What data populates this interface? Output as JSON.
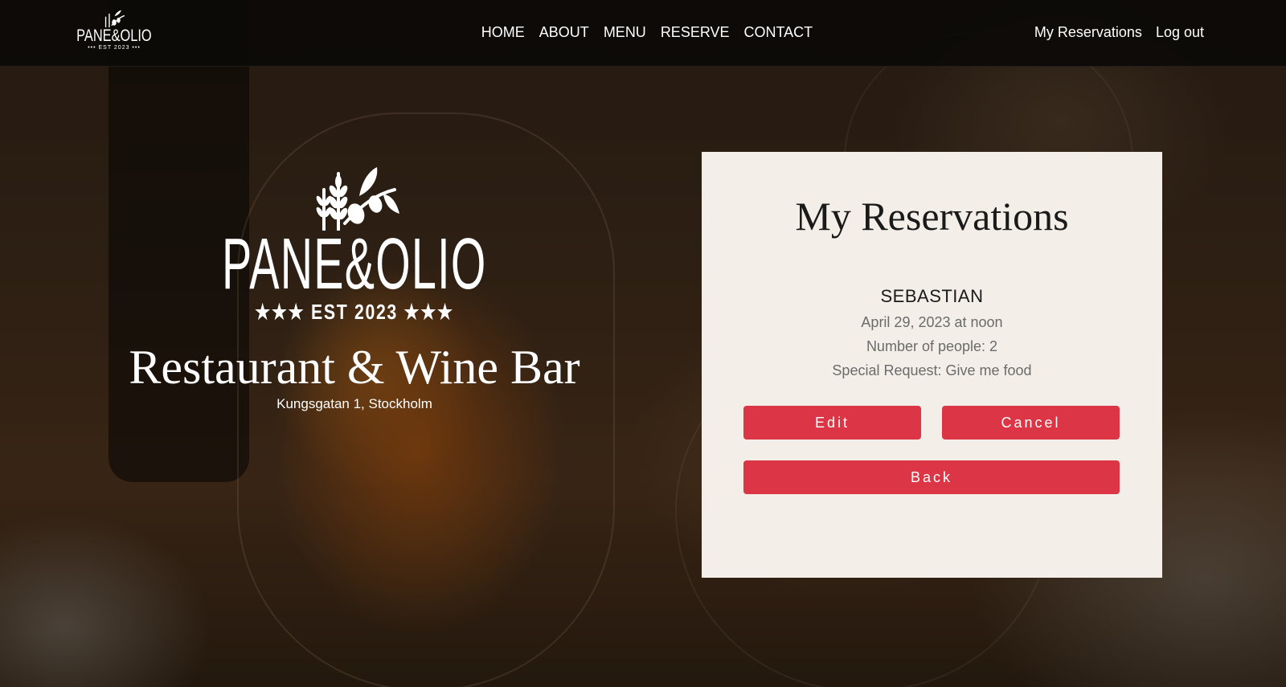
{
  "brand": {
    "name": "PANE&OLIO",
    "established": "★★★ EST 2023 ★★★",
    "established_small": "••• EST 2023 •••"
  },
  "nav": {
    "links": [
      "HOME",
      "ABOUT",
      "MENU",
      "RESERVE",
      "CONTACT"
    ],
    "account": [
      "My Reservations",
      "Log out"
    ]
  },
  "hero": {
    "tagline": "Restaurant & Wine Bar",
    "address": "Kungsgatan 1, Stockholm"
  },
  "reservations": {
    "title": "My Reservations",
    "item": {
      "name": "SEBASTIAN",
      "date": "April 29, 2023 at noon",
      "people": "Number of people: 2",
      "request": "Special Request: Give me food"
    },
    "buttons": {
      "edit": "Edit",
      "cancel": "Cancel",
      "back": "Back"
    }
  },
  "colors": {
    "accent": "#dc3545",
    "card_bg": "#f3efe8",
    "navbar_bg": "#0c0a08"
  },
  "icons": [
    "olive-wheat-logo-icon"
  ]
}
